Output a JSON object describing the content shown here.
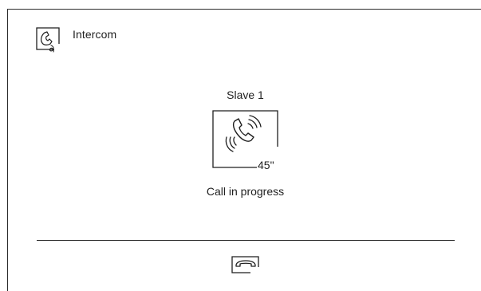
{
  "header": {
    "title": "Intercom",
    "icon": "intercom-handset-icon"
  },
  "call": {
    "peer_name": "Slave 1",
    "timer": "45\"",
    "status": "Call in progress",
    "icon": "ringing-handset-icon"
  },
  "footer": {
    "hangup_icon": "hang-up-icon"
  },
  "colors": {
    "background": "#ffffff",
    "foreground": "#1f1f1f",
    "lines": "#2b2b2b"
  }
}
